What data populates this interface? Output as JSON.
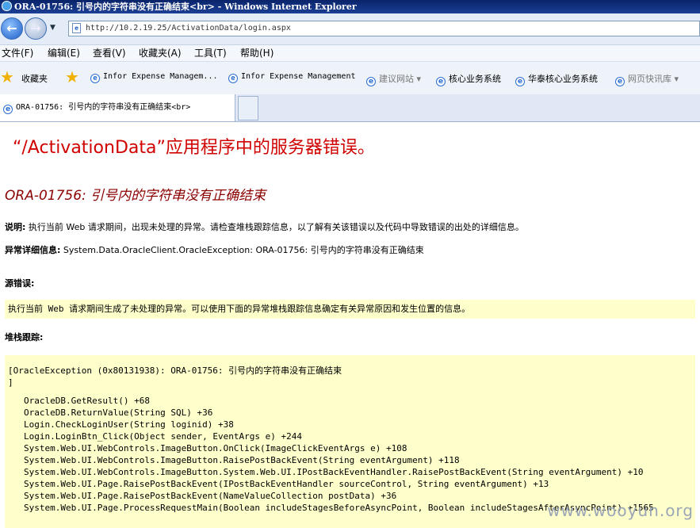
{
  "window": {
    "title": "ORA-01756: 引号内的字符串没有正确结束<br> - Windows Internet Explorer"
  },
  "address": {
    "url": "http://10.2.19.25/ActivationData/login.aspx"
  },
  "menu": [
    "文件(F)",
    "编辑(E)",
    "查看(V)",
    "收藏夹(A)",
    "工具(T)",
    "帮助(H)"
  ],
  "favorites": {
    "label": "收藏夹",
    "items": [
      "Infor Expense Managem...",
      "Infor Expense Management",
      "建议网站 ▾",
      "核心业务系统",
      "华泰核心业务系统",
      "网页快讯库 ▾"
    ]
  },
  "tab": {
    "title": "ORA-01756: 引号内的字符串没有正确结束<br>"
  },
  "page": {
    "heading": "“/ActivationData”应用程序中的服务器错误。",
    "error_title": "ORA-01756: 引号内的字符串没有正确结束",
    "desc_label": "说明:",
    "desc_text": "执行当前 Web 请求期间，出现未处理的异常。请检查堆栈跟踪信息，以了解有关该错误以及代码中导致错误的出处的详细信息。",
    "detail_label": "异常详细信息:",
    "detail_text": "System.Data.OracleClient.OracleException: ORA-01756: 引号内的字符串没有正确结束",
    "source_label": "源错误:",
    "source_text": "执行当前 Web 请求期间生成了未处理的异常。可以使用下面的异常堆栈跟踪信息确定有关异常原因和发生位置的信息。",
    "stack_label": "堆栈跟踪:",
    "stack_lines": [
      "[OracleException (0x80131938): ORA-01756: 引号内的字符串没有正确结束",
      "]",
      "OracleDB.GetResult() +68",
      "OracleDB.ReturnValue(String SQL) +36",
      "Login.CheckLoginUser(String loginid) +38",
      "Login.LoginBtn_Click(Object sender, EventArgs e) +244",
      "System.Web.UI.WebControls.ImageButton.OnClick(ImageClickEventArgs e) +108",
      "System.Web.UI.WebControls.ImageButton.RaisePostBackEvent(String eventArgument) +118",
      "System.Web.UI.WebControls.ImageButton.System.Web.UI.IPostBackEventHandler.RaisePostBackEvent(String eventArgument) +10",
      "System.Web.UI.Page.RaisePostBackEvent(IPostBackEventHandler sourceControl, String eventArgument) +13",
      "System.Web.UI.Page.RaisePostBackEvent(NameValueCollection postData) +36",
      "System.Web.UI.Page.ProcessRequestMain(Boolean includeStagesBeforeAsyncPoint, Boolean includeStagesAfterAsyncPoint) +1565"
    ]
  },
  "watermark": "www.wooyun.org"
}
